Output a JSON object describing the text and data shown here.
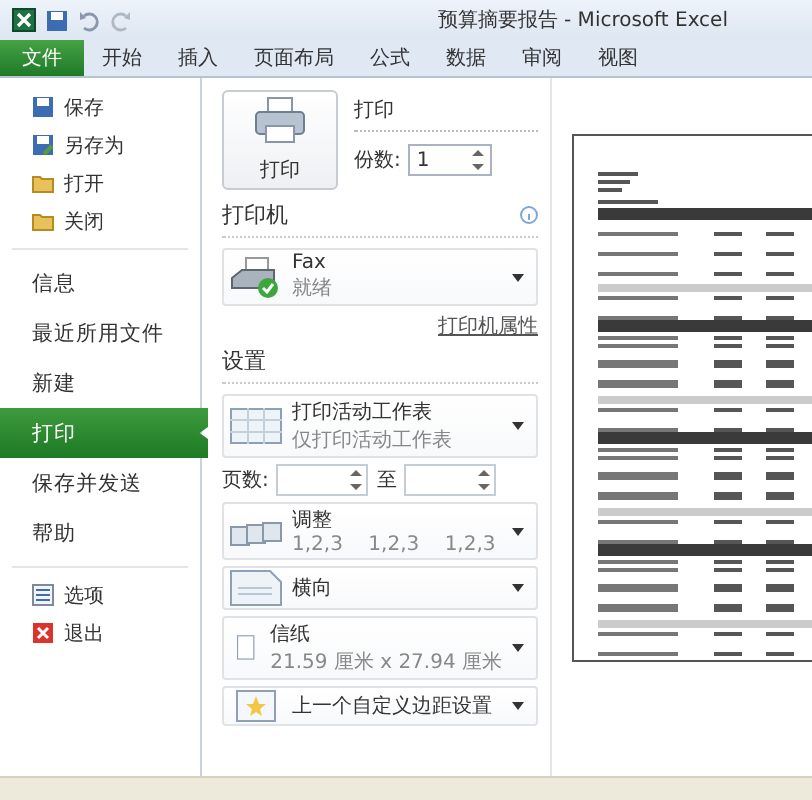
{
  "window": {
    "title": "预算摘要报告 - Microsoft Excel"
  },
  "ribbon_tabs": [
    {
      "label": "文件",
      "selected": true
    },
    {
      "label": "开始",
      "selected": false
    },
    {
      "label": "插入",
      "selected": false
    },
    {
      "label": "页面布局",
      "selected": false
    },
    {
      "label": "公式",
      "selected": false
    },
    {
      "label": "数据",
      "selected": false
    },
    {
      "label": "审阅",
      "selected": false
    },
    {
      "label": "视图",
      "selected": false
    }
  ],
  "sidebar": {
    "items": [
      {
        "kind": "command",
        "label": "保存",
        "selected": false
      },
      {
        "kind": "command",
        "label": "另存为",
        "selected": false
      },
      {
        "kind": "command",
        "label": "打开",
        "selected": false
      },
      {
        "kind": "command",
        "label": "关闭",
        "selected": false
      },
      {
        "kind": "page",
        "label": "信息",
        "selected": false
      },
      {
        "kind": "page",
        "label": "最近所用文件",
        "selected": false
      },
      {
        "kind": "page",
        "label": "新建",
        "selected": false
      },
      {
        "kind": "page",
        "label": "打印",
        "selected": true
      },
      {
        "kind": "page",
        "label": "保存并发送",
        "selected": false
      },
      {
        "kind": "page",
        "label": "帮助",
        "selected": false
      },
      {
        "kind": "command",
        "label": "选项",
        "selected": false
      },
      {
        "kind": "command",
        "label": "退出",
        "selected": false
      }
    ]
  },
  "print": {
    "button": "打印",
    "heading": "打印",
    "copies_label": "份数:",
    "copies": "1"
  },
  "printer": {
    "heading": "打印机",
    "name": "Fax",
    "status": "就绪",
    "properties_link": "打印机属性"
  },
  "settings": {
    "heading": "设置",
    "options": [
      {
        "kind": "sheets",
        "title": "打印活动工作表",
        "subtitle": "仅打印活动工作表"
      },
      {
        "kind": "pages",
        "label": "页数:",
        "to": "至"
      },
      {
        "kind": "collate",
        "title": "调整",
        "subtitle": "1,2,3    1,2,3    1,2,3"
      },
      {
        "kind": "orientation",
        "title": "横向"
      },
      {
        "kind": "paper",
        "title": "信纸",
        "subtitle": "21.59 厘米 x 27.94 厘米"
      },
      {
        "kind": "margins",
        "title": "上一个自定义边距设置"
      }
    ]
  }
}
